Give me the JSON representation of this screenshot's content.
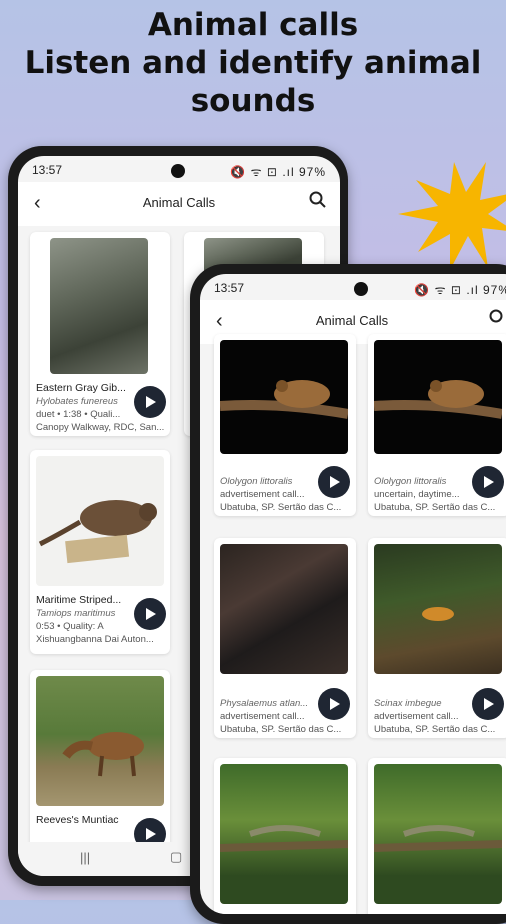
{
  "promo": {
    "line1": "Animal calls",
    "line2": "Listen and identify animal",
    "line3": "sounds"
  },
  "colors": {
    "accent": "#1f2633",
    "star": "#f7b500",
    "background_top": "#b5c3e6",
    "background_mid": "#d7c2dc"
  },
  "back_phone": {
    "status": {
      "time": "13:57",
      "icons": "🔇 ᯤ ⊡ .ıl 97%"
    },
    "appbar": {
      "title": "Animal Calls",
      "back_icon": "arrow-left",
      "search_icon": "magnifier"
    },
    "cards": [
      {
        "name": "Eastern Gray Gib...",
        "sci": "Hylobates funereus",
        "line1": "duet • 1:38 • Quali...",
        "line2": "Canopy Walkway, RDC, San..."
      },
      {
        "name": "Maritime Striped...",
        "sci": "Tamiops maritimus",
        "line1": "0:53 • Quality: A",
        "line2": "Xishuangbanna Dai Auton..."
      },
      {
        "name": "Reeves's Muntiac",
        "sci": "",
        "line1": "",
        "line2": ""
      }
    ],
    "nav": {
      "recents": "|||",
      "home": "▢"
    }
  },
  "front_phone": {
    "status": {
      "time": "13:57",
      "icons": "🔇 ᯤ ⊡ .ıl 97%"
    },
    "appbar": {
      "title": "Animal Calls",
      "back_icon": "arrow-left",
      "search_icon": "magnifier"
    },
    "cards": [
      {
        "sci": "Ololygon littoralis",
        "line1": "advertisement call...",
        "line2": "Ubatuba, SP. Sertão das C..."
      },
      {
        "sci": "Ololygon littoralis",
        "line1": "uncertain, daytime...",
        "line2": "Ubatuba, SP. Sertão das C..."
      },
      {
        "sci": "Physalaemus atlan...",
        "line1": "advertisement call...",
        "line2": "Ubatuba, SP. Sertão das C..."
      },
      {
        "sci": "Scinax imbegue",
        "line1": "advertisement call...",
        "line2": "Ubatuba, SP. Sertão das C..."
      }
    ]
  }
}
